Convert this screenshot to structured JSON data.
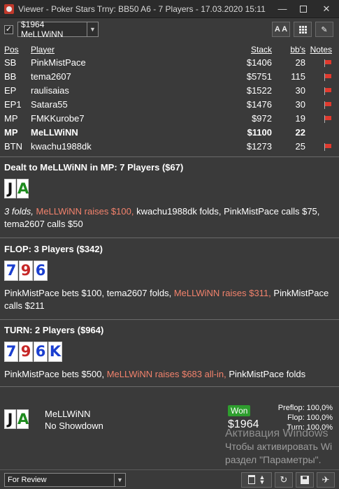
{
  "window": {
    "title": "Viewer - Poker Stars Trny: BB50 A6 - 7 Players - 17.03.2020 15:11",
    "minimize_glyph": "—",
    "close_glyph": "✕"
  },
  "toolbar": {
    "checkbox_glyph": "✓",
    "player_select_value": "$1964 MeLLWiNN",
    "font_button_label": "A A"
  },
  "players": {
    "headers": {
      "pos": "Pos",
      "player": "Player",
      "stack": "Stack",
      "bb": "bb's",
      "notes": "Notes"
    },
    "rows": [
      {
        "pos": "SB",
        "player": "PinkMistPace",
        "stack": "$1406",
        "bb": "28",
        "note": true
      },
      {
        "pos": "BB",
        "player": "tema2607",
        "stack": "$5751",
        "bb": "115",
        "note": true
      },
      {
        "pos": "EP",
        "player": "raulisaias",
        "stack": "$1522",
        "bb": "30",
        "note": true
      },
      {
        "pos": "EP1",
        "player": "Satara55",
        "stack": "$1476",
        "bb": "30",
        "note": true
      },
      {
        "pos": "MP",
        "player": "FMKKurobe7",
        "stack": "$972",
        "bb": "19",
        "note": true
      },
      {
        "pos": "MP",
        "player": "MeLLWiNN",
        "stack": "$1100",
        "bb": "22",
        "note": false
      },
      {
        "pos": "BTN",
        "player": "kwachu1988dk",
        "stack": "$1273",
        "bb": "25",
        "note": true
      }
    ]
  },
  "preflop": {
    "title": "Dealt to MeLLWiNN in MP: 7 Players ($67)",
    "cards": [
      {
        "rank": "J",
        "suit": "s"
      },
      {
        "rank": "A",
        "suit": "c"
      }
    ],
    "a1": "3 folds,",
    "a2": "MeLLWiNN raises $100,",
    "a3": "kwachu1988dk folds, PinkMistPace calls $75, tema2607 calls $50"
  },
  "flop": {
    "title": "FLOP: 3 Players ($342)",
    "cards": [
      {
        "rank": "7",
        "suit": "d"
      },
      {
        "rank": "9",
        "suit": "h"
      },
      {
        "rank": "6",
        "suit": "d"
      }
    ],
    "a1": "PinkMistPace bets $100, tema2607 folds,",
    "a2": "MeLLWiNN raises $311,",
    "a3": "PinkMistPace calls $211"
  },
  "turn": {
    "title": "TURN: 2 Players ($964)",
    "cards": [
      {
        "rank": "7",
        "suit": "d"
      },
      {
        "rank": "9",
        "suit": "h"
      },
      {
        "rank": "6",
        "suit": "d"
      },
      {
        "rank": "K",
        "suit": "d"
      }
    ],
    "a1": "PinkMistPace bets $500,",
    "a2": "MeLLWiNN raises $683 all-in,",
    "a3": "PinkMistPace folds"
  },
  "result": {
    "cards": [
      {
        "rank": "J",
        "suit": "s"
      },
      {
        "rank": "A",
        "suit": "c"
      }
    ],
    "player": "MeLLWiNN",
    "showdown": "No Showdown",
    "won_label": "Won",
    "won_amount": "$1964",
    "equity": [
      "Preflop: 100,0%",
      "Flop: 100,0%",
      "Turn: 100,0%"
    ]
  },
  "watermark": {
    "line1": "Активация Windows",
    "line2": "Чтобы активировать Wi",
    "line3": "раздел \"Параметры\"."
  },
  "footer": {
    "filter_value": "For Review",
    "refresh_glyph": "↻"
  },
  "colors": {
    "background": "#3a3a3a",
    "highlight": "#f2826c",
    "spades": "#111111",
    "clubs": "#1e8a1e",
    "diamonds": "#1b3fd0",
    "hearts": "#c62828",
    "won_badge": "#2e9e2e"
  }
}
